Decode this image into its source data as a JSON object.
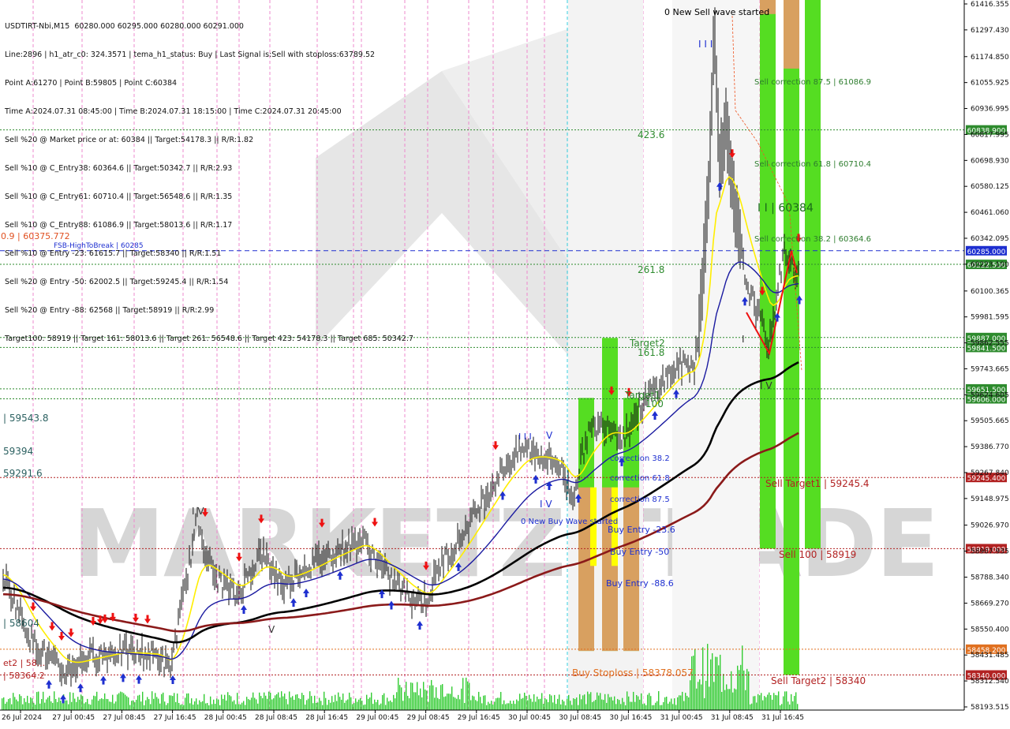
{
  "chart_data": {
    "type": "candlestick",
    "symbol": "USDTIRT-Nbi,M15",
    "ohlc_header": [
      "60280.000",
      "60295.000",
      "60280.000",
      "60291.000"
    ],
    "info_lines": [
      "Line:2896 | h1_atr_c0: 324.3571 | tema_h1_status: Buy | Last Signal is:Sell with stoploss:63789.52",
      "Line:2896 | h1_atr_c0: 324.3571 | tema_h1_status: Buy | Last Signal is:Sell with stoploss:63789.52",
      "Point A:61270 | Point B:59805 | Point C:60384",
      "Time A:2024.07.31 08:45:00 | Time B:2024.07.31 18:15:00 | Time C:2024.07.31 20:45:00",
      "Sell %20 @ Market price or at: 60384 || Target:54178.3 || R/R:1.82",
      "Sell %10 @ C_Entry38: 60364.6 || Target:50342.7 || R/R:2.93",
      "Sell %10 @ C_Entry61: 60710.4 || Target:56548.6 || R/R:1.35",
      "Sell %10 @ C_Entry88: 61086.9 || Target:58013.6 || R/R:1.17",
      "Sell %10 @ Entry -23: 61615.7 || Target:58340 || R/R:1.51",
      "Sell %20 @ Entry -50: 62002.5 || Target:59245.4 || R/R:1.54",
      "Sell %20 @ Entry -88: 62568 || Target:58919 || R/R:2.99",
      "Target100: 58919 || Target 161: 58013.6 || Target 261: 56548.6 || Target 423: 54178.3 || Target 685: 50342.7"
    ],
    "y_axis": {
      "min": 58150,
      "max": 61460,
      "ticks": [
        "61416.355",
        "61297.430",
        "61174.850",
        "61055.925",
        "60936.995",
        "60817.995",
        "60698.930",
        "60580.125",
        "60461.060",
        "60342.095",
        "60223.100",
        "60100.365",
        "59981.595",
        "59862.555",
        "59743.665",
        "59624.605",
        "59505.665",
        "59386.770",
        "59267.840",
        "59148.975",
        "59026.970",
        "58907.935",
        "58788.340",
        "58669.270",
        "58550.400",
        "58431.485",
        "58312.540",
        "58193.515"
      ]
    },
    "x_axis": {
      "ticks": [
        "26 Jul 2024",
        "27 Jul 00:45",
        "27 Jul 08:45",
        "27 Jul 16:45",
        "28 Jul 00:45",
        "28 Jul 08:45",
        "28 Jul 16:45",
        "29 Jul 00:45",
        "29 Jul 08:45",
        "29 Jul 16:45",
        "30 Jul 00:45",
        "30 Jul 08:45",
        "30 Jul 16:45",
        "31 Jul 00:45",
        "31 Jul 08:45",
        "31 Jul 16:45"
      ]
    },
    "horizontal_levels": [
      {
        "label": "60838.900",
        "value": 60838.9,
        "color": "#2e8b2e",
        "style": "dotted",
        "text": "423.6"
      },
      {
        "label": "60285.000",
        "value": 60285.0,
        "color": "#1e2fd0",
        "style": "dashed",
        "text": "FSB-HighToBreak | 60285"
      },
      {
        "label": "60222.500",
        "value": 60222.5,
        "color": "#2e8b2e",
        "style": "dotted",
        "text": "261.8"
      },
      {
        "label": "59887.000",
        "value": 59887.0,
        "color": "#2e8b2e",
        "style": "dotted",
        "text": "Target2"
      },
      {
        "label": "59841.500",
        "value": 59841.5,
        "color": "#2e8b2e",
        "style": "dotted",
        "text": "161.8"
      },
      {
        "label": "59651.500",
        "value": 59651.5,
        "color": "#2e8b2e",
        "style": "dotted",
        "text": "Target1"
      },
      {
        "label": "59606.000",
        "value": 59606.0,
        "color": "#2e8b2e",
        "style": "dotted",
        "text": "100"
      },
      {
        "label": "59245.400",
        "value": 59245.4,
        "color": "#b22222",
        "style": "dotted",
        "text": "Sell Target1 | 59245.4"
      },
      {
        "label": "58919.000",
        "value": 58919.0,
        "color": "#b22222",
        "style": "dotted",
        "text": "Sell 100 | 58919"
      },
      {
        "label": "58458.200",
        "value": 58458.2,
        "color": "#e07020",
        "style": "dotted",
        "text": "Buy Stoploss | 58378.057"
      },
      {
        "label": "58340.000",
        "value": 58340.0,
        "color": "#b22222",
        "style": "dotted",
        "text": "Sell Target2 | 58340"
      }
    ],
    "annotations": [
      {
        "text": "0 New Sell wave started",
        "color": "#000000"
      },
      {
        "text": "Sell correction 87.5 | 61086.9",
        "color": "#2e7d2e"
      },
      {
        "text": "Sell correction 61.8 | 60710.4",
        "color": "#2e7d2e"
      },
      {
        "text": "Sell correction 38.2 | 60364.6",
        "color": "#2e7d2e"
      },
      {
        "text": "I I | 60384",
        "color": "#1a6b1a"
      },
      {
        "text": "I I I",
        "color": "#1e2fd0"
      },
      {
        "text": "correction 38.2",
        "color": "#1e2fd0"
      },
      {
        "text": "correction 61.8",
        "color": "#1e2fd0"
      },
      {
        "text": "correction 87.5",
        "color": "#1e2fd0"
      },
      {
        "text": "0 New Buy Wave started",
        "color": "#1e2fd0"
      },
      {
        "text": "Buy Entry -23.6",
        "color": "#1e2fd0"
      },
      {
        "text": "Buy Entry -50",
        "color": "#1e2fd0"
      },
      {
        "text": "Buy Entry -88.6",
        "color": "#1e2fd0"
      },
      {
        "text": "0.9 | 60375.772",
        "color": "#e05020"
      },
      {
        "text": "| 59543.8",
        "color": "#2b6060"
      },
      {
        "text": "59394",
        "color": "#2b6060"
      },
      {
        "text": "59291.6",
        "color": "#2b6060"
      },
      {
        "text": "| 58604",
        "color": "#2b6060"
      },
      {
        "text": "| 58364.2",
        "color": "#b22222"
      },
      {
        "text": "et2 | 58...",
        "color": "#b22222"
      },
      {
        "text": "I V",
        "color": "#333333"
      },
      {
        "text": "V",
        "color": "#333333"
      },
      {
        "text": "I V",
        "color": "#333333"
      },
      {
        "text": "I",
        "color": "#333333"
      },
      {
        "text": "V",
        "color": "#1e2fd0"
      },
      {
        "text": "I V",
        "color": "#1e2fd0"
      }
    ],
    "watermark": "MARKETZITRADE",
    "series": [
      {
        "name": "price",
        "color": "#000000"
      },
      {
        "name": "ma_fast",
        "color": "#ffee00"
      },
      {
        "name": "ma_mid",
        "color": "#1a1aa0"
      },
      {
        "name": "ma_slow_black",
        "color": "#000000"
      },
      {
        "name": "ma_slow_red",
        "color": "#8b1a1a"
      }
    ],
    "colors": {
      "green_bar": "#55dd22",
      "orange_bar": "#d8a060",
      "yellow_bar": "#ffff00",
      "sell_arrow": "#ee1111",
      "buy_arrow": "#1e2fd0",
      "volume": "#33cc33"
    }
  }
}
